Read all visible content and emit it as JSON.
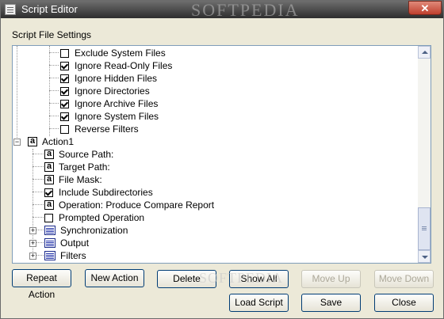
{
  "window": {
    "title": "Script Editor",
    "watermark": "SOFTPEDIA",
    "close_glyph": "✕"
  },
  "group_label": "Script File Settings",
  "tree": {
    "filter_items": [
      {
        "label": "Exclude System Files",
        "checked": false
      },
      {
        "label": "Ignore Read-Only Files",
        "checked": true
      },
      {
        "label": "Ignore Hidden Files",
        "checked": true
      },
      {
        "label": "Ignore Directories",
        "checked": true
      },
      {
        "label": "Ignore Archive Files",
        "checked": true
      },
      {
        "label": "Ignore System Files",
        "checked": true
      },
      {
        "label": "Reverse Filters",
        "checked": false
      }
    ],
    "action_node": {
      "icon": "a",
      "label": "Action1",
      "expander": "−"
    },
    "action_items": [
      {
        "type": "value",
        "icon": "a",
        "label": "Source Path:"
      },
      {
        "type": "value",
        "icon": "a",
        "label": "Target Path:"
      },
      {
        "type": "value",
        "icon": "a",
        "label": "File Mask:"
      },
      {
        "type": "check",
        "label": "Include Subdirectories",
        "checked": true
      },
      {
        "type": "value",
        "icon": "a",
        "label": "Operation: Produce Compare Report"
      },
      {
        "type": "check",
        "label": "Prompted Operation",
        "checked": false
      }
    ],
    "folder_items": [
      {
        "label": "Synchronization",
        "expander": "+"
      },
      {
        "label": "Output",
        "expander": "+"
      },
      {
        "label": "Filters",
        "expander": "+"
      }
    ]
  },
  "buttons": {
    "repeat_action": "Repeat Action",
    "new_action": "New Action",
    "delete": "Delete",
    "show_all": "Show All",
    "move_up": "Move Up",
    "move_down": "Move Down",
    "load_script": "Load Script",
    "save": "Save",
    "close": "Close"
  },
  "colors": {
    "button_border": "#003c74",
    "disabled_text": "#aca899"
  }
}
